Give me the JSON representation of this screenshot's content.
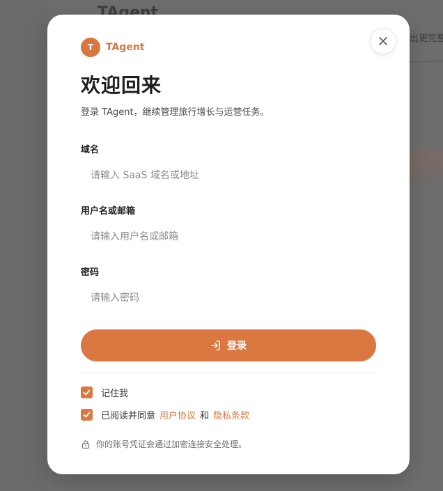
{
  "background": {
    "app_title": "TAgent",
    "side_text": "出更完整"
  },
  "modal": {
    "brand": {
      "badge_letter": "T",
      "name": "TAgent",
      "accent_color": "#d9763f"
    },
    "title": "欢迎回来",
    "subtitle": "登录 TAgent，继续管理旅行增长与运营任务。",
    "close_icon": "close-icon",
    "fields": {
      "domain": {
        "label": "域名",
        "placeholder": "请输入 SaaS 域名或地址",
        "value": ""
      },
      "username": {
        "label": "用户名或邮箱",
        "placeholder": "请输入用户名或邮箱",
        "value": ""
      },
      "password": {
        "label": "密码",
        "placeholder": "请输入密码",
        "value": ""
      }
    },
    "login_button": {
      "label": "登录",
      "icon": "login-icon"
    },
    "remember_me": {
      "label": "记住我",
      "checked": true
    },
    "agreement": {
      "prefix": "已阅读并同意",
      "user_agreement": "用户协议",
      "and": "和",
      "privacy_policy": "隐私条款",
      "checked": true
    },
    "security_note": {
      "icon": "lock-icon",
      "text": "你的账号凭证会通过加密连接安全处理。"
    }
  }
}
